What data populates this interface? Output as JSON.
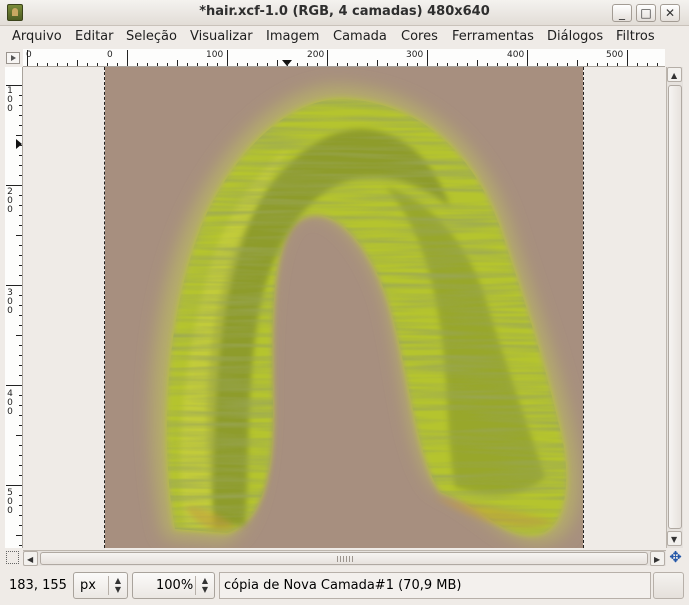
{
  "window": {
    "title": "*hair.xcf-1.0 (RGB, 4 camadas) 480x640",
    "minimize": "_",
    "maximize": "□",
    "close": "✕"
  },
  "menu": [
    {
      "label": "Arquivo"
    },
    {
      "label": "Editar"
    },
    {
      "label": "Seleção"
    },
    {
      "label": "Visualizar"
    },
    {
      "label": "Imagem"
    },
    {
      "label": "Camada"
    },
    {
      "label": "Cores"
    },
    {
      "label": "Ferramentas"
    },
    {
      "label": "Diálogos"
    },
    {
      "label": "Filtros"
    }
  ],
  "rulers": {
    "horizontal_labels": [
      "0",
      "0",
      "100",
      "200",
      "300",
      "400",
      "500"
    ],
    "vertical_labels": [
      "100",
      "200",
      "300",
      "400",
      "500"
    ]
  },
  "status": {
    "coordinates": "183, 155",
    "unit": "px",
    "zoom": "100%",
    "layer_info": "cópia de Nova Camada#1 (70,9 MB)"
  },
  "colors": {
    "image_background": "#a78f7f",
    "hair_main": "#b5c42e",
    "hair_shadow": "#6f7d2a",
    "window_bg": "#efebe7"
  },
  "icons": {
    "app": "gimp-wilber-icon",
    "ruler_menu": "triangle-right-icon",
    "quickmask": "quick-mask-icon",
    "navigate": "navigate-cross-icon"
  }
}
